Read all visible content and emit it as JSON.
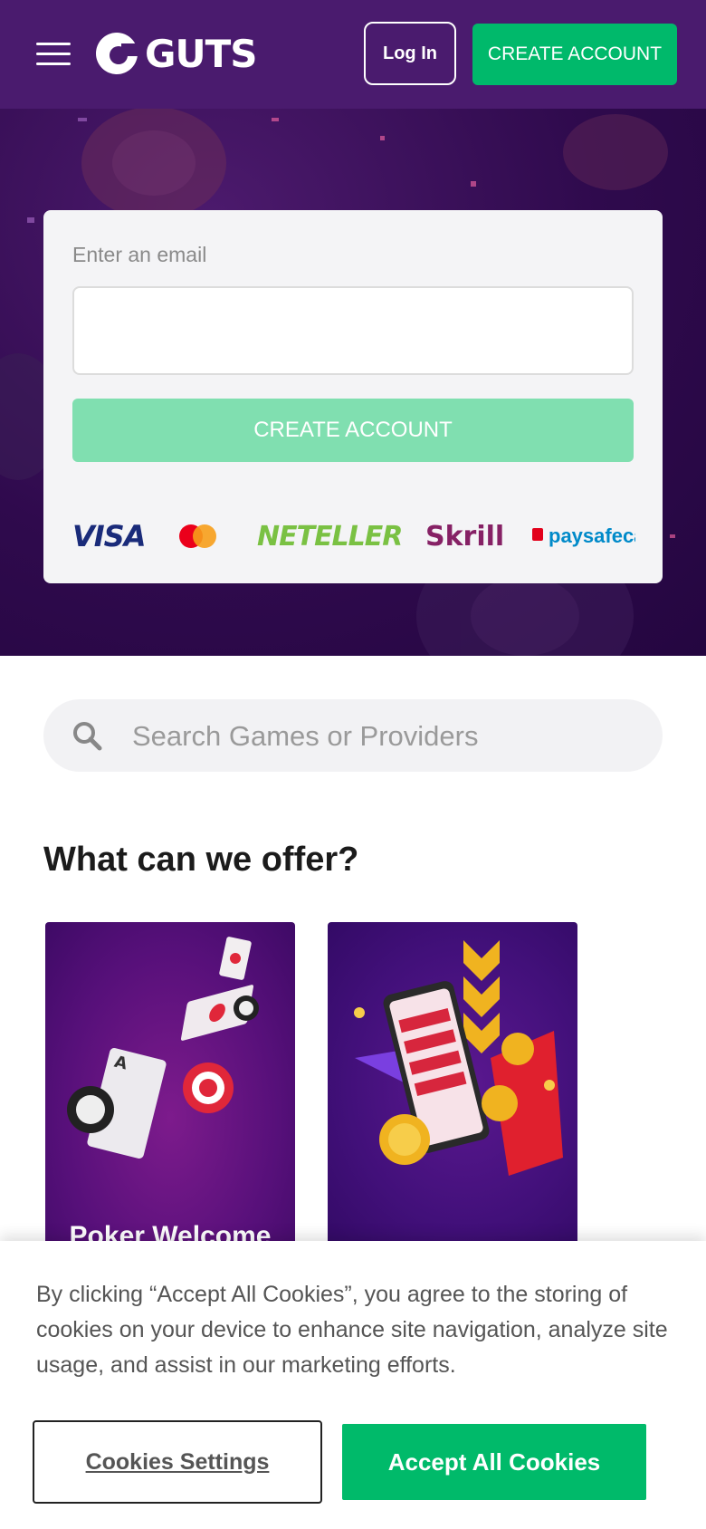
{
  "header": {
    "brand_name": "GUTS",
    "login_label": "Log In",
    "create_account_label": "CREATE ACCOUNT"
  },
  "signup": {
    "email_label": "Enter an email",
    "email_value": "",
    "create_account_label": "CREATE ACCOUNT",
    "payment_methods": [
      "VISA",
      "Mastercard",
      "NETELLER",
      "Skrill",
      "paysafecard"
    ]
  },
  "search": {
    "placeholder": "Search Games or Providers"
  },
  "offers": {
    "title": "What can we offer?",
    "cards": [
      {
        "title": "Poker Welcome"
      },
      {
        "title": ""
      }
    ]
  },
  "cookie_banner": {
    "text": "By clicking “Accept All Cookies”, you agree to the storing of cookies on your device to enhance site navigation, analyze site usage, and assist in our marketing efforts.",
    "settings_label": "Cookies Settings",
    "accept_label": "Accept All Cookies"
  },
  "colors": {
    "header_bg": "#4a1b6e",
    "accent_green": "#00b96b",
    "hero_bg": "#2f0a4d"
  }
}
